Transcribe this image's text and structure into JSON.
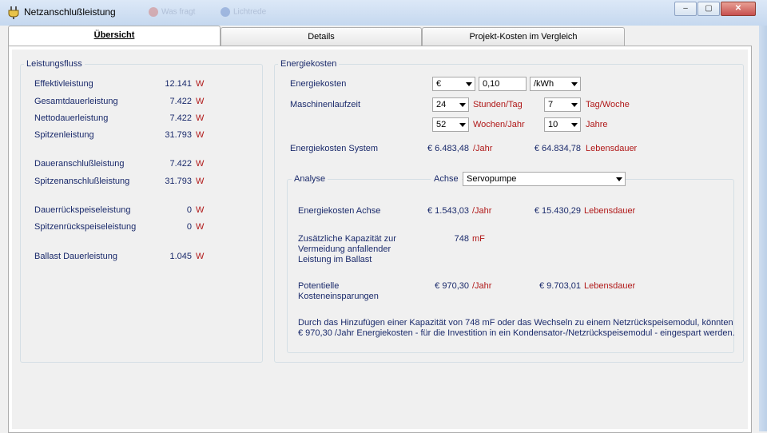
{
  "window": {
    "title": "Netzanschlußleistung",
    "ghost_items": [
      "Was fragt",
      "Lichtrede"
    ],
    "buttons": {
      "minimize": "–",
      "maximize": "▢",
      "close": "✕"
    }
  },
  "tabs": [
    {
      "label": "Übersicht",
      "active": true
    },
    {
      "label": "Details",
      "active": false
    },
    {
      "label": "Projekt-Kosten im Vergleich",
      "active": false
    }
  ],
  "leistungsfluss": {
    "title": "Leistungsfluss",
    "rows": [
      {
        "label": "Effektivleistung",
        "value": "12.141",
        "unit": "W"
      },
      {
        "label": "Gesamtdauerleistung",
        "value": "7.422",
        "unit": "W"
      },
      {
        "label": "Nettodauerleistung",
        "value": "7.422",
        "unit": "W"
      },
      {
        "label": "Spitzenleistung",
        "value": "31.793",
        "unit": "W"
      },
      {
        "label": "Daueranschlußleistung",
        "value": "7.422",
        "unit": "W"
      },
      {
        "label": "Spitzenanschlußleistung",
        "value": "31.793",
        "unit": "W"
      },
      {
        "label": "Dauerrückspeiseleistung",
        "value": "0",
        "unit": "W"
      },
      {
        "label": "Spitzenrückspeiseleistung",
        "value": "0",
        "unit": "W"
      },
      {
        "label": "Ballast Dauerleistung",
        "value": "1.045",
        "unit": "W"
      }
    ]
  },
  "energiekosten": {
    "title": "Energiekosten",
    "kosten_label": "Energiekosten",
    "currency": "€",
    "price": "0,10",
    "price_unit": "/kWh",
    "laufzeit_label": "Maschinenlaufzeit",
    "stunden": "24",
    "stunden_unit": "Stunden/Tag",
    "tage": "7",
    "tage_unit": "Tag/Woche",
    "wochen": "52",
    "wochen_unit": "Wochen/Jahr",
    "jahre": "10",
    "jahre_unit": "Jahre",
    "system_label": "Energiekosten System",
    "system_year": "€ 6.483,48",
    "per_year_unit": "/Jahr",
    "system_life": "€ 64.834,78",
    "life_unit": "Lebensdauer"
  },
  "analyse": {
    "title": "Analyse",
    "achse_label": "Achse",
    "achse_value": "Servopumpe",
    "achse_kosten_label": "Energiekosten Achse",
    "achse_year": "€ 1.543,03",
    "achse_year_unit": "/Jahr",
    "achse_life": "€ 15.430,29",
    "achse_life_unit": "Lebensdauer",
    "kapazitaet_label": "Zusätzliche Kapazität zur Vermeidung anfallender Leistung im Ballast",
    "kapazitaet_value": "748",
    "kapazitaet_unit": "mF",
    "einsparung_label": "Potentielle Kosteneinsparungen",
    "einsparung_year": "€ 970,30",
    "einsparung_year_unit": "/Jahr",
    "einsparung_life": "€ 9.703,01",
    "einsparung_life_unit": "Lebensdauer",
    "summary": "Durch das Hinzufügen einer Kapazität von 748 mF oder das Wechseln zu einem Netzrückspeisemodul, könnten € 970,30 /Jahr Energiekosten - für die Investition in ein Kondensator-/Netzrückspeisemodul - eingespart werden."
  },
  "colors": {
    "label": "#1a2a6b",
    "unit": "#b01818"
  }
}
